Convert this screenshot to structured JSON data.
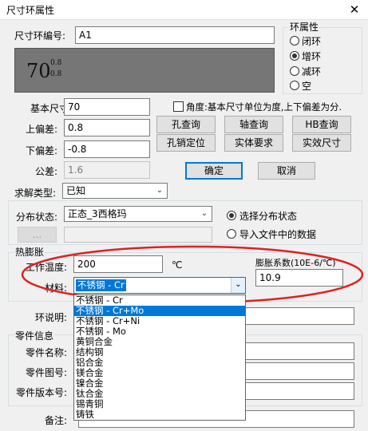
{
  "window": {
    "title": "尺寸环属性",
    "close_glyph": "✕"
  },
  "ring_id": {
    "label": "尺寸环编号:",
    "value": "A1"
  },
  "preview": {
    "base": "70",
    "upper": "0.8",
    "lower": "-0.8"
  },
  "ring_property": {
    "legend": "环属性",
    "options": [
      "闭环",
      "增环",
      "减环",
      "空"
    ],
    "selected": "增环"
  },
  "dimension": {
    "base_label": "基本尺寸:",
    "base_value": "70",
    "upper_label": "上偏差:",
    "upper_value": "0.8",
    "lower_label": "下偏差:",
    "lower_value": "-0.8",
    "tolerance_label": "公差:",
    "tolerance_value": "1.6"
  },
  "angle_checkbox": {
    "label": "角度:基本尺寸单位为度,上下偏差为分.",
    "checked": false
  },
  "buttons": {
    "hole_query": "孔查询",
    "shaft_query": "轴查询",
    "hb_query": "HB查询",
    "hole_pin": "孔销定位",
    "entity_req": "实体要求",
    "actual_size": "实效尺寸",
    "ok": "确定",
    "cancel": "取消",
    "browse": "..."
  },
  "solve_type": {
    "label": "求解类型:",
    "value": "已知"
  },
  "distribution": {
    "label": "分布状态:",
    "value": "正态_3西格玛",
    "options": [
      "选择分布状态",
      "导入文件中的数据"
    ],
    "selected": "选择分布状态"
  },
  "thermal": {
    "legend": "热膨胀",
    "temp_label": "工作温度:",
    "temp_value": "200",
    "temp_unit": "℃",
    "coef_label": "膨胀系数(10E-6/℃)",
    "coef_value": "10.9",
    "material_label": "材料:",
    "material_value": "不锈钢 - Cr"
  },
  "material_options": [
    "不锈钢 - Cr",
    "不锈钢 - Cr+Mo",
    "不锈钢 - Cr+Ni",
    "不锈钢 - Mo",
    "黄铜合金",
    "结构钢",
    "铝合金",
    "镁合金",
    "镍合金",
    "钛合金",
    "锡青铜",
    "铸铁"
  ],
  "material_highlighted": "不锈钢 - Cr+Mo",
  "ring_note": {
    "label": "环说明:"
  },
  "part_info": {
    "legend": "零件信息",
    "name_label": "零件名称:",
    "drawing_label": "零件图号:",
    "version_label": "零件版本号:"
  },
  "remark": {
    "label": "备注:"
  },
  "colors": {
    "accent": "#0078d7",
    "annotation": "#e0201e",
    "preview_bg": "#767676"
  }
}
